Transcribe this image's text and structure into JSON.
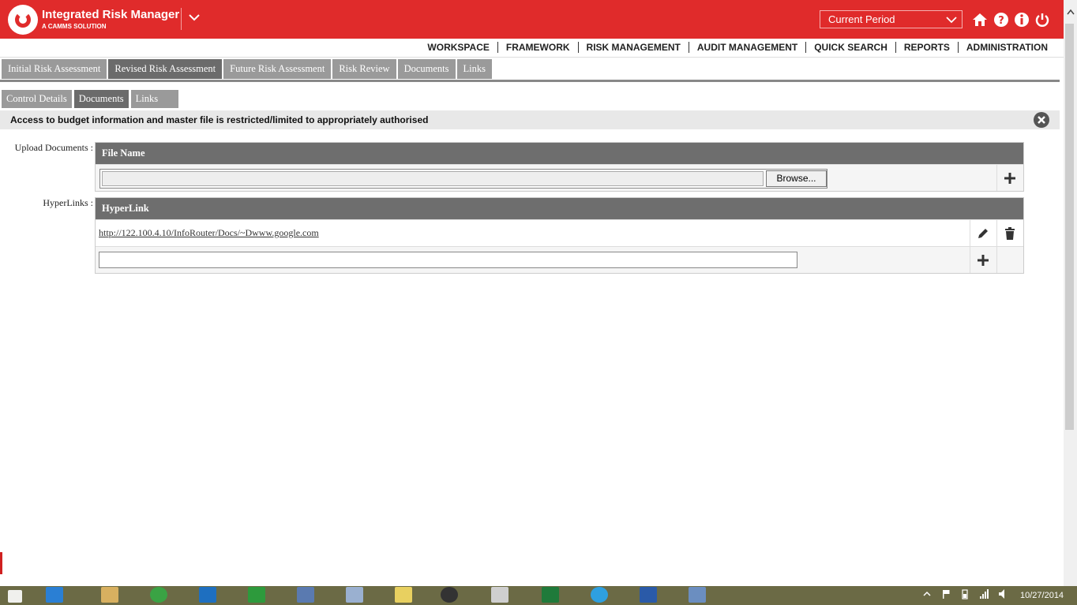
{
  "header": {
    "app_title": "Integrated Risk Manager",
    "app_subtitle": "A CAMMS SOLUTION",
    "period_select": "Current Period",
    "icons": [
      "home-icon",
      "help-icon",
      "info-icon",
      "power-icon"
    ]
  },
  "menu": [
    "WORKSPACE",
    "FRAMEWORK",
    "RISK MANAGEMENT",
    "AUDIT MANAGEMENT",
    "QUICK SEARCH",
    "REPORTS",
    "ADMINISTRATION"
  ],
  "tabs": [
    {
      "label": "Initial Risk Assessment",
      "active": false
    },
    {
      "label": "Revised Risk Assessment",
      "active": true
    },
    {
      "label": "Future Risk Assessment",
      "active": false
    },
    {
      "label": "Risk Review",
      "active": false
    },
    {
      "label": "Documents",
      "active": false
    },
    {
      "label": "Links",
      "active": false
    }
  ],
  "subtabs": [
    {
      "label": "Control Details",
      "active": false
    },
    {
      "label": "Documents",
      "active": true
    },
    {
      "label": "Links",
      "active": false
    }
  ],
  "notice": "Access to budget information and master file is restricted/limited to appropriately authorised",
  "upload": {
    "label": "Upload Documents :",
    "header": "File Name",
    "browse": "Browse..."
  },
  "hyperlinks": {
    "label": "HyperLinks :",
    "header": "HyperLink",
    "items": [
      "http://122.100.4.10/InfoRouter/Docs/~Dwww.google.com"
    ]
  },
  "taskbar": {
    "apps": [
      "start-icon",
      "ie-icon",
      "explorer-icon",
      "chrome-icon",
      "outlook-icon",
      "project-icon",
      "calculator-icon",
      "paint-icon",
      "sticky-notes-icon",
      "wordpress-icon",
      "snipping-icon",
      "excel-icon",
      "skype-icon",
      "word-icon",
      "rdp-icon"
    ],
    "date": "10/27/2014"
  },
  "colors": {
    "header_red": "#e02b2b",
    "tab_grey": "#9a9a9a",
    "tab_active": "#6b6b6b",
    "taskbar": "#6b6a45"
  }
}
